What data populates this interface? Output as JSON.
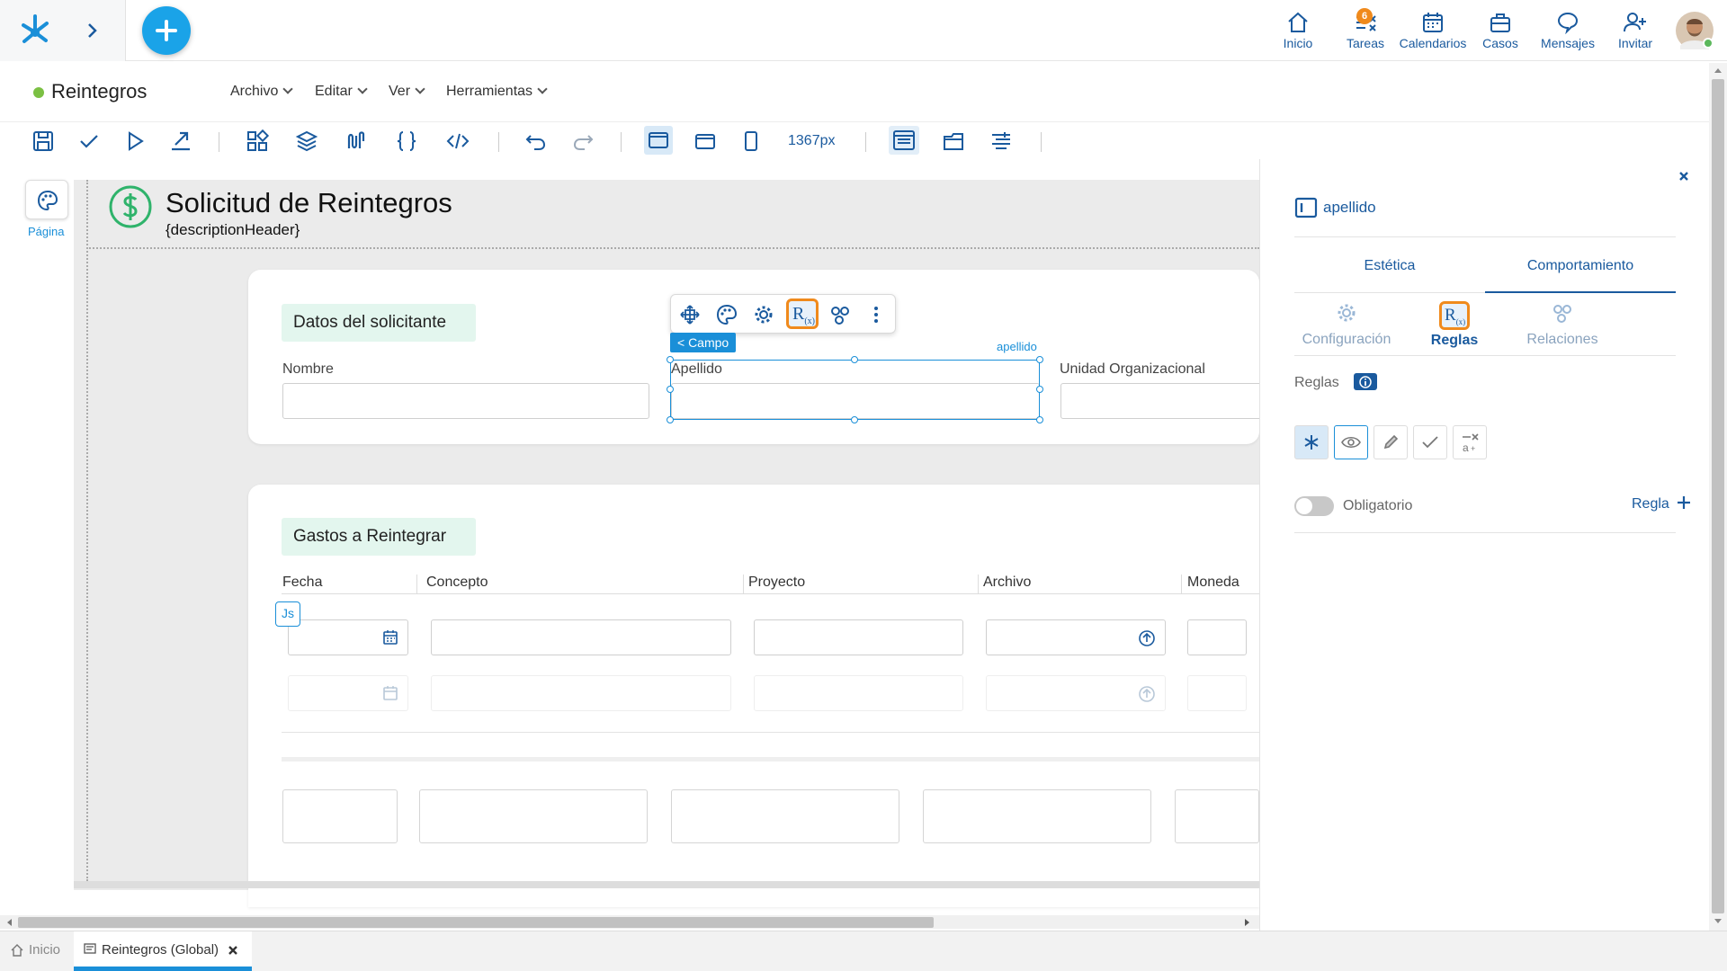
{
  "nav": {
    "items": [
      {
        "label": "Inicio",
        "icon": "home-icon"
      },
      {
        "label": "Tareas",
        "icon": "tasks-icon",
        "badge": "6"
      },
      {
        "label": "Calendarios",
        "icon": "calendar-icon"
      },
      {
        "label": "Casos",
        "icon": "briefcase-icon"
      },
      {
        "label": "Mensajes",
        "icon": "chat-icon"
      },
      {
        "label": "Invitar",
        "icon": "add-user-icon"
      }
    ]
  },
  "app": {
    "title": "Reintegros",
    "status_color": "#7bc043",
    "menus": [
      "Archivo",
      "Editar",
      "Ver",
      "Herramientas"
    ]
  },
  "toolbar": {
    "width_label": "1367px"
  },
  "canvas": {
    "page_label": "Página",
    "form_title": "Solicitud de Reintegros",
    "form_subtitle": "{descriptionHeader}",
    "section1": {
      "title": "Datos del solicitante",
      "fields": [
        "Nombre",
        "Apellido",
        "Unidad Organizacional"
      ]
    },
    "selection": {
      "badge": "< Campo",
      "field_name": "apellido"
    },
    "section2": {
      "title": "Gastos a Reintegrar",
      "columns": [
        "Fecha",
        "Concepto",
        "Proyecto",
        "Archivo",
        "Moneda"
      ],
      "js_badge": "Js"
    }
  },
  "panel": {
    "field_name": "apellido",
    "tabs": [
      "Estética",
      "Comportamiento"
    ],
    "subtabs": [
      "Configuración",
      "Reglas",
      "Relaciones"
    ],
    "rules_label": "Reglas",
    "toggle_label": "Obligatorio",
    "add_rule_label": "Regla",
    "accent": "#1a5a9e",
    "highlight": "#f08a1c"
  },
  "bottom": {
    "tabs": [
      "Inicio",
      "Reintegros (Global)"
    ]
  }
}
